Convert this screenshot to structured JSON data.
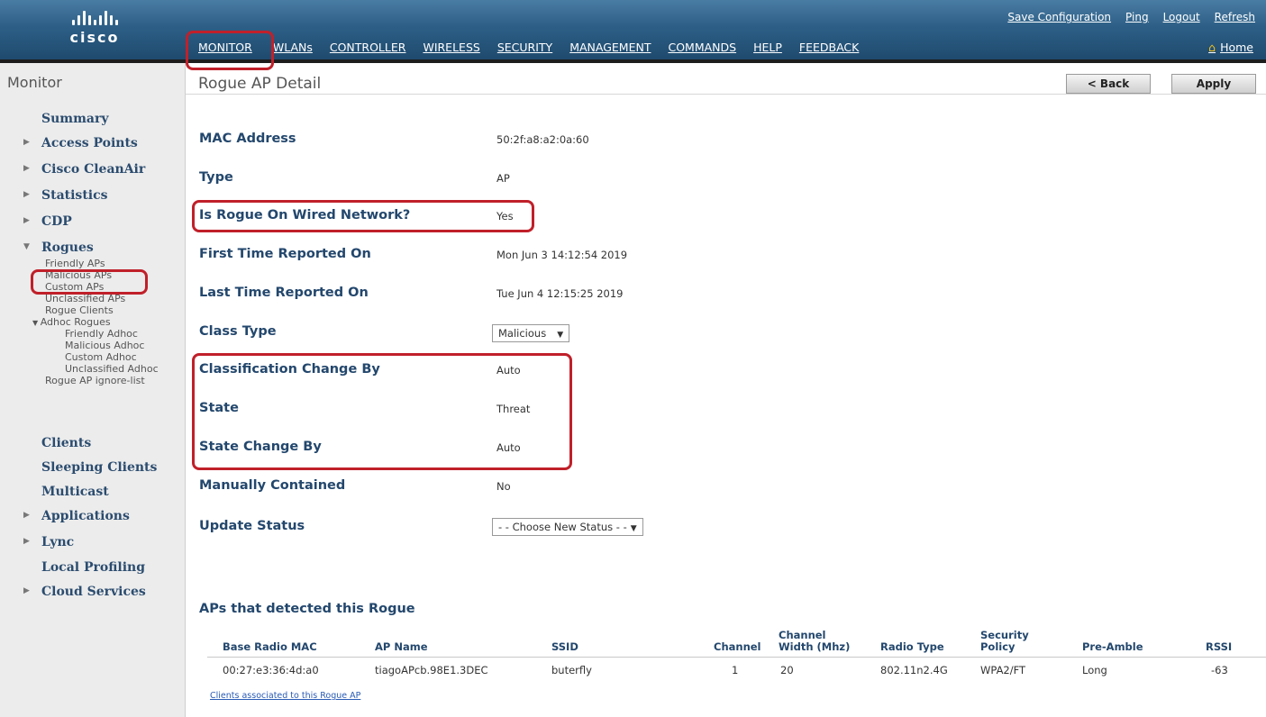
{
  "header": {
    "logo_text": "cisco",
    "nav": [
      "MONITOR",
      "WLANs",
      "CONTROLLER",
      "WIRELESS",
      "SECURITY",
      "MANAGEMENT",
      "COMMANDS",
      "HELP",
      "FEEDBACK"
    ],
    "top_links": [
      "Save Configuration",
      "Ping",
      "Logout",
      "Refresh"
    ],
    "home_label": "Home",
    "brand_color": "#2d5f86"
  },
  "sidebar": {
    "title": "Monitor",
    "items": [
      {
        "label": "Summary",
        "arrow": ""
      },
      {
        "label": "Access Points",
        "arrow": "▶"
      },
      {
        "label": "Cisco CleanAir",
        "arrow": "▶"
      },
      {
        "label": "Statistics",
        "arrow": "▶"
      },
      {
        "label": "CDP",
        "arrow": "▶"
      },
      {
        "label": "Rogues",
        "arrow": "▼"
      }
    ],
    "rogue_subitems": [
      "Friendly APs",
      "Malicious APs",
      "Custom APs",
      "Unclassified APs",
      "Rogue Clients"
    ],
    "adhoc_label": "Adhoc Rogues",
    "adhoc_subitems": [
      "Friendly Adhoc",
      "Malicious Adhoc",
      "Custom Adhoc",
      "Unclassified Adhoc"
    ],
    "ignore_list": "Rogue AP ignore-list",
    "items_after": [
      {
        "label": "Clients",
        "arrow": ""
      },
      {
        "label": "Sleeping Clients",
        "arrow": ""
      },
      {
        "label": "Multicast",
        "arrow": ""
      },
      {
        "label": "Applications",
        "arrow": "▶"
      },
      {
        "label": "Lync",
        "arrow": "▶"
      },
      {
        "label": "Local Profiling",
        "arrow": ""
      },
      {
        "label": "Cloud Services",
        "arrow": "▶"
      }
    ]
  },
  "main": {
    "title": "Rogue AP Detail",
    "back_label": "< Back",
    "apply_label": "Apply",
    "fields": [
      {
        "label": "MAC Address",
        "value": "50:2f:a8:a2:0a:60"
      },
      {
        "label": "Type",
        "value": "AP"
      },
      {
        "label": "Is Rogue On Wired Network?",
        "value": "Yes"
      },
      {
        "label": "First Time Reported On",
        "value": "Mon Jun  3 14:12:54 2019"
      },
      {
        "label": "Last Time Reported On",
        "value": "Tue Jun  4 12:15:25 2019"
      },
      {
        "label": "Class Type",
        "value": "Malicious"
      },
      {
        "label": "Classification Change By",
        "value": "Auto"
      },
      {
        "label": "State",
        "value": "Threat"
      },
      {
        "label": "State Change By",
        "value": "Auto"
      },
      {
        "label": "Manually Contained",
        "value": "No"
      },
      {
        "label": "Update Status",
        "value": "- - Choose New Status - -"
      }
    ],
    "aps_title": "APs that detected this Rogue",
    "table": {
      "headers": [
        "Base Radio MAC",
        "AP Name",
        "SSID",
        "Channel",
        "Channel Width (Mhz)",
        "Radio Type",
        "Security Policy",
        "Pre-Amble",
        "RSSI"
      ],
      "rows": [
        [
          "00:27:e3:36:4d:a0",
          "tiagoAPcb.98E1.3DEC",
          "buterfly",
          "1",
          "20",
          "802.11n2.4G",
          "WPA2/FT",
          "Long",
          "-63"
        ]
      ]
    },
    "clients_link": "Clients associated to this Rogue AP"
  }
}
